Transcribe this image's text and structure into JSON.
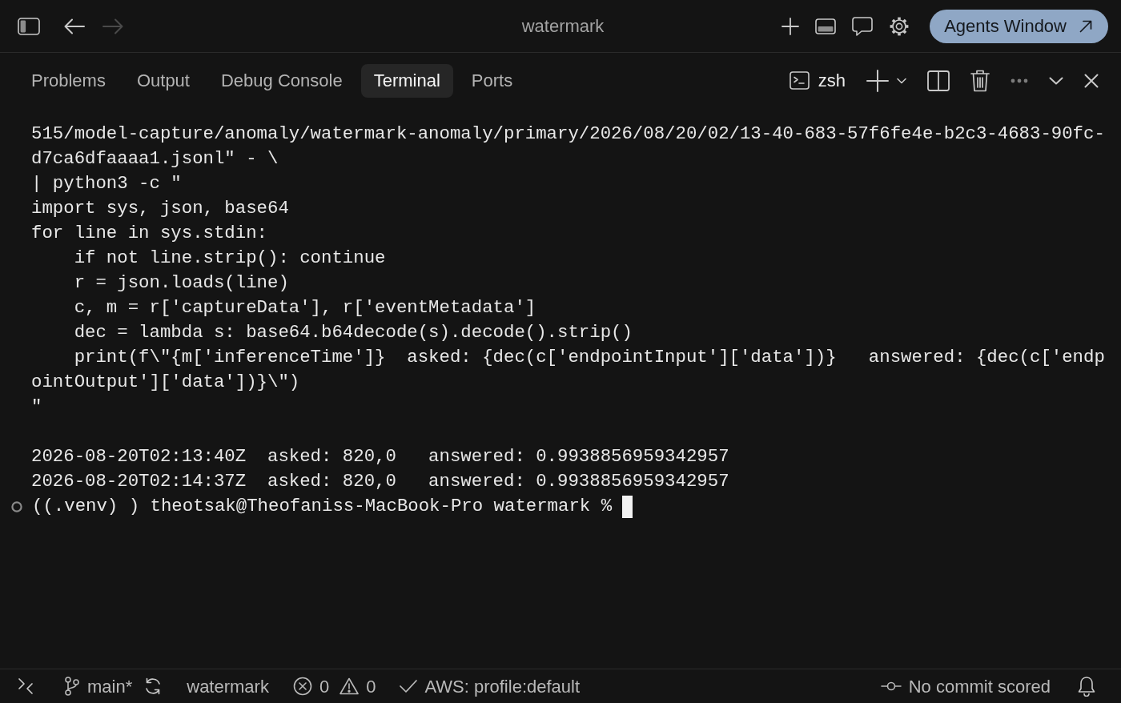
{
  "title_bar": {
    "nav": [
      {
        "kind": "back",
        "disabled": false
      },
      {
        "kind": "forward",
        "disabled": true
      }
    ],
    "title": "watermark",
    "agents_button": "Agents Window"
  },
  "panel": {
    "tabs": [
      {
        "label": "Problems",
        "selected": false
      },
      {
        "label": "Output",
        "selected": false
      },
      {
        "label": "Debug Console",
        "selected": false
      },
      {
        "label": "Terminal",
        "selected": true
      },
      {
        "label": "Ports",
        "selected": false
      }
    ],
    "shell": "zsh"
  },
  "terminal": {
    "command_lines": [
      "515/model-capture/anomaly/watermark-anomaly/primary/2026/08/20/02/13-40-683-57f6fe4e-b2c3-4683-90fc-",
      "d7ca6dfaaaa1.jsonl\" - \\",
      "| python3 -c \"",
      "import sys, json, base64",
      "for line in sys.stdin:",
      "    if not line.strip(): continue",
      "    r = json.loads(line)",
      "    c, m = r['captureData'], r['eventMetadata']",
      "    dec = lambda s: base64.b64decode(s).decode().strip()",
      "    print(f\\\"{m['inferenceTime']}  asked: {dec(c['endpointInput']['data'])}   answered: {dec(c['endp",
      "ointOutput']['data'])}\\\")",
      "\""
    ],
    "output_lines": [
      "2026-08-20T02:13:40Z  asked: 820,0   answered: 0.9938856959342957",
      "2026-08-20T02:14:37Z  asked: 820,0   answered: 0.9938856959342957"
    ],
    "prompt": "((.venv) ) theotsak@Theofaniss-MacBook-Pro watermark %"
  },
  "status_bar": {
    "branch": "main*",
    "folder": "watermark",
    "errors": "0",
    "warnings": "0",
    "aws_profile": "AWS: profile:default",
    "commit": "No commit scored"
  }
}
